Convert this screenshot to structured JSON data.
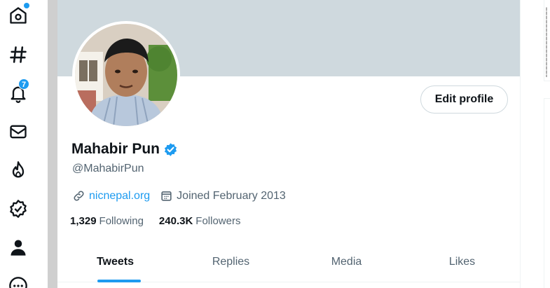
{
  "nav": {
    "items": [
      {
        "name": "home",
        "icon": "home-icon",
        "has_dot": true
      },
      {
        "name": "explore",
        "icon": "hashtag-icon"
      },
      {
        "name": "notifications",
        "icon": "bell-icon",
        "badge": "7"
      },
      {
        "name": "messages",
        "icon": "envelope-icon"
      },
      {
        "name": "trending",
        "icon": "flame-icon"
      },
      {
        "name": "verified",
        "icon": "verified-badge-icon"
      },
      {
        "name": "profile",
        "icon": "person-icon"
      },
      {
        "name": "more",
        "icon": "more-circle-icon"
      }
    ]
  },
  "profile": {
    "display_name": "Mahabir Pun",
    "handle": "@MahabirPun",
    "website": "nicnepal.org",
    "joined": "Joined February 2013",
    "following_count": "1,329",
    "following_label": "Following",
    "followers_count": "240.3K",
    "followers_label": "Followers",
    "edit_button": "Edit profile"
  },
  "tabs": [
    {
      "label": "Tweets",
      "active": true
    },
    {
      "label": "Replies"
    },
    {
      "label": "Media"
    },
    {
      "label": "Likes"
    }
  ],
  "colors": {
    "accent": "#1d9bf0",
    "banner": "#cfd9de",
    "secondary_text": "#536471",
    "primary_text": "#0f1419"
  }
}
